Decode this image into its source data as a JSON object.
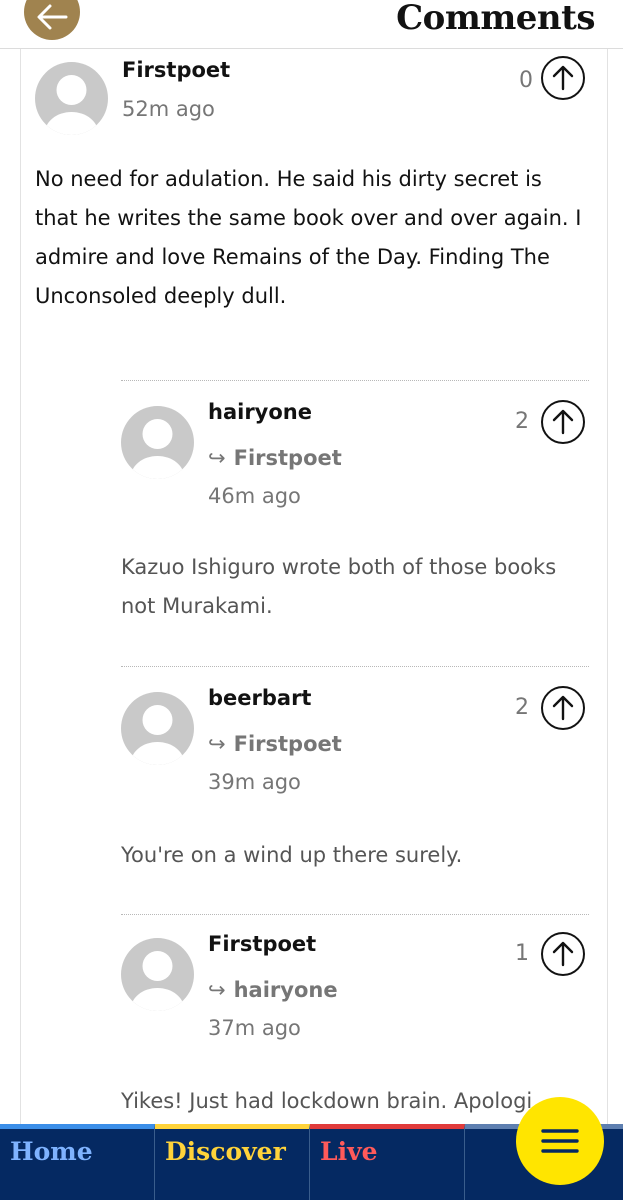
{
  "header": {
    "title": "Comments",
    "back_icon": "arrow-left-icon"
  },
  "comments": [
    {
      "author": "Firstpoet",
      "reply_to": "",
      "time": "52m ago",
      "recommends": "0",
      "body": "No need for adulation. He said his dirty secret is\nthat he writes the same book over and over again. I\nadmire and love Remains of the Day. Finding The\nUnconsoled deeply dull."
    },
    {
      "author": "hairyone",
      "reply_to": "Firstpoet",
      "time": "46m ago",
      "recommends": "2",
      "body": "Kazuo Ishiguro wrote both of those books\nnot Murakami."
    },
    {
      "author": "beerbart",
      "reply_to": "Firstpoet",
      "time": "39m ago",
      "recommends": "2",
      "body": "You're on a wind up there surely."
    },
    {
      "author": "Firstpoet",
      "reply_to": "hairyone",
      "time": "37m ago",
      "recommends": "1",
      "body": "Yikes! Just had lockdown brain. Apologi"
    }
  ],
  "reply_arrow": "↪",
  "nav": {
    "home": "Home",
    "discover": "Discover",
    "live": "Live",
    "menu_icon": "hamburger-menu-icon"
  },
  "colors": {
    "back_button": "#a0834f",
    "nav_background": "#052962",
    "home": "#7fb3ff",
    "discover": "#ffd33a",
    "live": "#ff5a5a",
    "menu_button": "#ffe500"
  }
}
